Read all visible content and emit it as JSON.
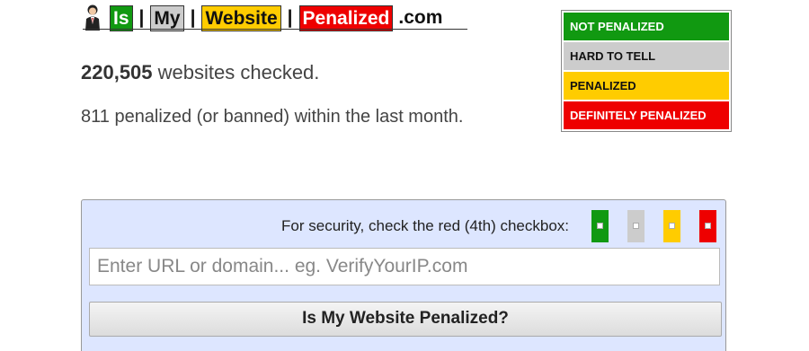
{
  "logo": {
    "part1": "Is",
    "part2": "My",
    "part3": "Website",
    "part4": "Penalized",
    "separator": "|",
    "suffix": ".com",
    "mascot_icon": "businessman-icon"
  },
  "stats": {
    "checked_count": "220,505",
    "checked_label": " websites checked.",
    "penalized_text": "811 penalized (or banned) within the last month."
  },
  "legend": {
    "items": [
      {
        "label": "NOT PENALIZED",
        "color": "#119911"
      },
      {
        "label": "HARD TO TELL",
        "color": "#cccccc"
      },
      {
        "label": "PENALIZED",
        "color": "#ffcc00"
      },
      {
        "label": "DEFINITELY PENALIZED",
        "color": "#ee0000"
      }
    ]
  },
  "form": {
    "security_text": "For security, check the red (4th) checkbox:",
    "checkbox_colors": [
      "#119911",
      "#cccccc",
      "#ffcc00",
      "#ee0000"
    ],
    "url_placeholder": "Enter URL or domain... eg. VerifyYourIP.com",
    "url_value": "",
    "submit_label": "Is My Website Penalized?"
  }
}
